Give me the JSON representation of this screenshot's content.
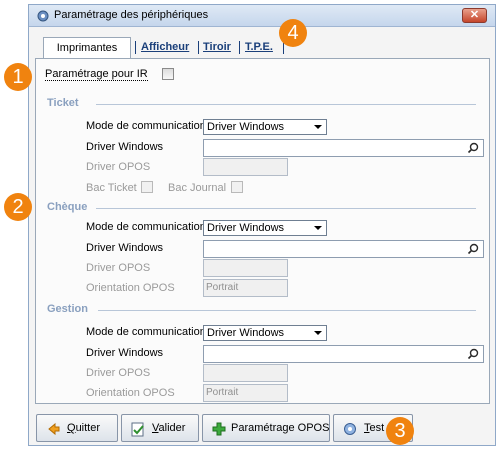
{
  "window": {
    "title": "Paramétrage des périphériques",
    "close_label": "✕"
  },
  "tabs": [
    {
      "label": "Imprimantes"
    },
    {
      "label": "Afficheur"
    },
    {
      "label": "Tiroir"
    },
    {
      "label": "T.P.E."
    }
  ],
  "ir_setting": {
    "label": "Paramétrage pour IR",
    "checked": false
  },
  "ticket": {
    "title": "Ticket",
    "mode_label": "Mode de communication",
    "mode_value": "Driver Windows",
    "driver_windows_label": "Driver Windows",
    "driver_windows_value": "",
    "driver_opos_label": "Driver OPOS",
    "bac_ticket_label": "Bac Ticket",
    "bac_journal_label": "Bac Journal"
  },
  "cheque": {
    "title": "Chèque",
    "mode_label": "Mode de communication",
    "mode_value": "Driver Windows",
    "driver_windows_label": "Driver Windows",
    "driver_opos_label": "Driver OPOS",
    "orientation_label": "Orientation OPOS",
    "orientation_value": "Portrait"
  },
  "gestion": {
    "title": "Gestion",
    "mode_label": "Mode de communication",
    "mode_value": "Driver Windows",
    "driver_windows_label": "Driver Windows",
    "driver_opos_label": "Driver OPOS",
    "orientation_label": "Orientation OPOS",
    "orientation_value": "Portrait"
  },
  "buttons": {
    "quit_u": "Q",
    "quit_rest": "uitter",
    "validate_u": "V",
    "validate_rest": "alider",
    "opos": "Paramétrage OPOS",
    "test_u": "T",
    "test_rest": "est"
  },
  "badges": [
    "1",
    "2",
    "3",
    "4"
  ],
  "colors": {
    "badge": "#f0830f",
    "section": "#8aa0bf",
    "tab_text": "#1a3f7a"
  }
}
